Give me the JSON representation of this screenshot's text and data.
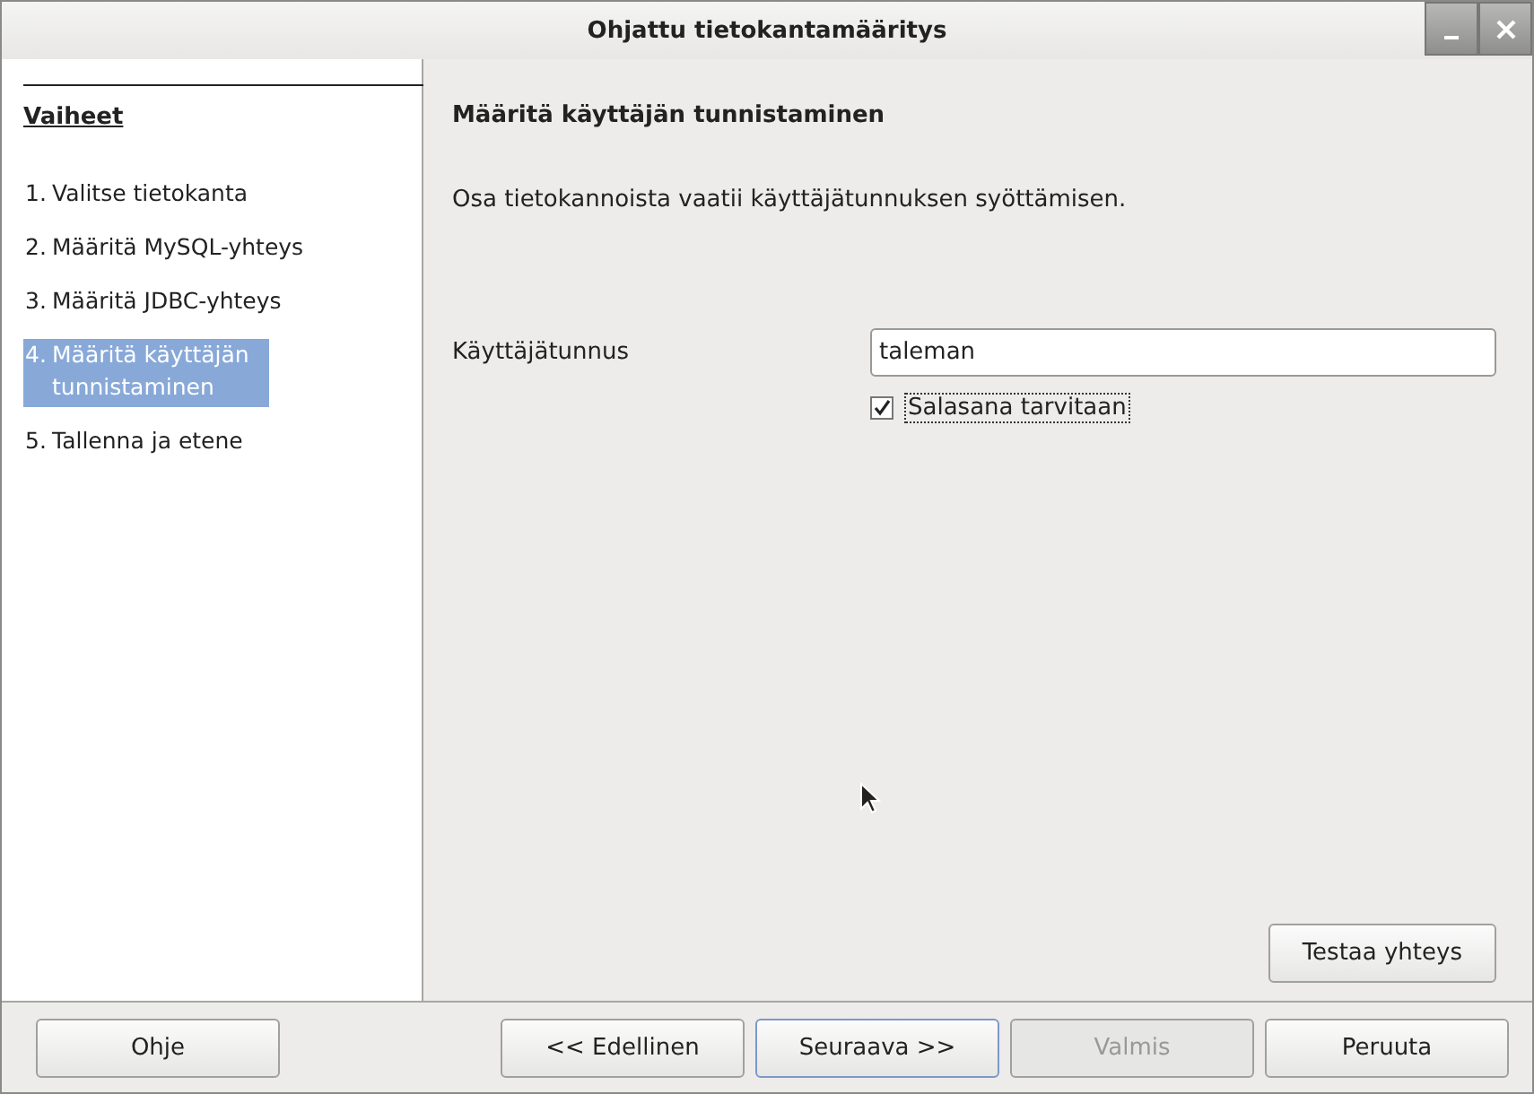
{
  "window": {
    "title": "Ohjattu tietokantamääritys"
  },
  "sidebar": {
    "heading": "Vaiheet",
    "items": [
      {
        "number": "1.",
        "label": "Valitse tietokanta",
        "selected": false
      },
      {
        "number": "2.",
        "label": "Määritä MySQL-yhteys",
        "selected": false
      },
      {
        "number": "3.",
        "label": "Määritä JDBC-yhteys",
        "selected": false
      },
      {
        "number": "4.",
        "label": "Määritä käyttäjän tunnistaminen",
        "selected": true
      },
      {
        "number": "5.",
        "label": "Tallenna ja etene",
        "selected": false
      }
    ]
  },
  "page": {
    "title": "Määritä käyttäjän tunnistaminen",
    "description": "Osa tietokannoista vaatii käyttäjätunnuksen syöttämisen.",
    "username": {
      "label": "Käyttäjätunnus",
      "value": "taleman"
    },
    "password_required": {
      "label": "Salasana tarvitaan",
      "checked": true
    },
    "test_button": "Testaa yhteys"
  },
  "buttons": [
    {
      "label": "Ohje",
      "disabled": false,
      "default": false
    },
    {
      "label": "<< Edellinen",
      "disabled": false,
      "default": false
    },
    {
      "label": "Seuraava >>",
      "disabled": false,
      "default": true
    },
    {
      "label": "Valmis",
      "disabled": true,
      "default": false
    },
    {
      "label": "Peruuta",
      "disabled": false,
      "default": false
    }
  ]
}
